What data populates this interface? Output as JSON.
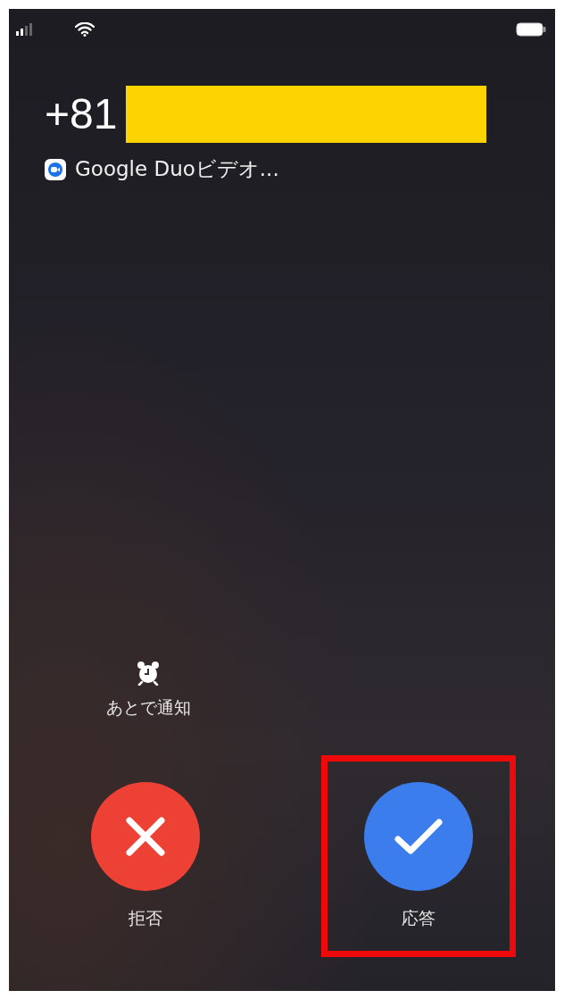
{
  "caller": {
    "number": "+81",
    "redacted": true,
    "app_label": "Google Duoビデオ..."
  },
  "remind": {
    "label": "あとで通知"
  },
  "actions": [
    {
      "kind": "decline",
      "label": "拒否",
      "highlighted": false
    },
    {
      "kind": "accept",
      "label": "応答",
      "highlighted": true
    }
  ]
}
